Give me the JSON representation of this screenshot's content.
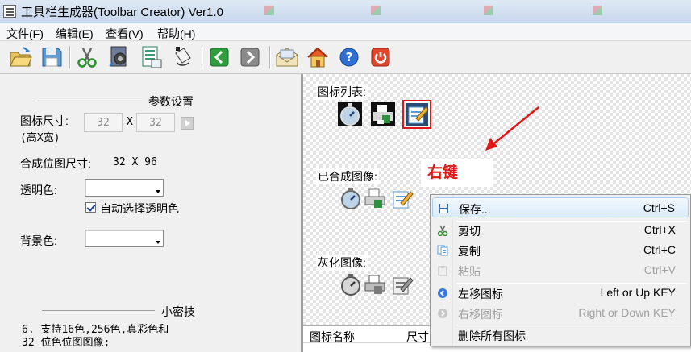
{
  "window": {
    "title": "工具栏生成器(Toolbar Creator) Ver1.0"
  },
  "menubar": {
    "items": [
      "文件(F)",
      "编辑(E)",
      "查看(V)",
      "帮助(H)"
    ]
  },
  "toolbar": {
    "buttons": [
      "open-icon",
      "save-icon",
      "cut-icon",
      "gear-icon",
      "export-icon",
      "bucket-icon",
      "move-left-icon",
      "move-right-icon",
      "mail-icon",
      "home-icon",
      "help-icon",
      "exit-icon"
    ]
  },
  "settings": {
    "section_title": "参数设置",
    "icon_size_label": "图标尺寸:",
    "icon_size_hint": "(高X宽)",
    "icon_height": "32",
    "x_sep": "X",
    "icon_width": "32",
    "composite_size_label": "合成位图尺寸:",
    "composite_size_value": "32 X 96",
    "transparent_label": "透明色:",
    "auto_transparent_label": "自动选择透明色",
    "auto_transparent_checked": true,
    "background_label": "背景色:"
  },
  "tips": {
    "section_title": "小密技",
    "text_line1": "6. 支持16色,256色,真彩色和",
    "text_line2": "32 位色位图图像;"
  },
  "preview": {
    "icon_list_label": "图标列表:",
    "composite_label": "已合成图像:",
    "gray_label": "灰化图像:",
    "annotation": "右键"
  },
  "list": {
    "columns": [
      "图标名称",
      "尺寸"
    ]
  },
  "context_menu": {
    "items": [
      {
        "label": "保存...",
        "shortcut": "Ctrl+S",
        "icon": "save-icon",
        "highlighted": true,
        "disabled": false
      },
      {
        "label": "剪切",
        "shortcut": "Ctrl+X",
        "icon": "cut-icon",
        "highlighted": false,
        "disabled": false
      },
      {
        "label": "复制",
        "shortcut": "Ctrl+C",
        "icon": "copy-icon",
        "highlighted": false,
        "disabled": false
      },
      {
        "label": "粘贴",
        "shortcut": "Ctrl+V",
        "icon": "paste-icon",
        "highlighted": false,
        "disabled": true
      },
      {
        "label": "左移图标",
        "shortcut": "Left or Up KEY",
        "icon": "move-left-icon",
        "highlighted": false,
        "disabled": false
      },
      {
        "label": "右移图标",
        "shortcut": "Right or Down KEY",
        "icon": "move-right-icon",
        "highlighted": false,
        "disabled": true
      },
      {
        "label": "删除所有图标",
        "shortcut": "",
        "icon": "",
        "highlighted": false,
        "disabled": false
      }
    ]
  },
  "colors": {
    "annotation_red": "#e01818",
    "highlight_border": "#aeccef"
  }
}
